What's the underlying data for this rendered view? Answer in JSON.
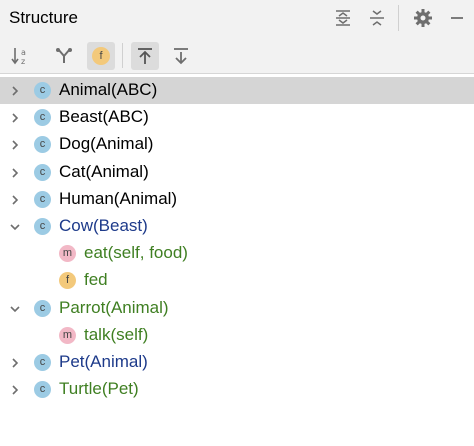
{
  "panel": {
    "title": "Structure"
  },
  "header_icons": [
    "expand-all-icon",
    "collapse-all-icon",
    "gear-icon",
    "minimize-icon"
  ],
  "toolbar": {
    "buttons": [
      {
        "name": "sort-alphabetically-icon"
      },
      {
        "name": "show-inherited-icon"
      },
      {
        "name": "show-fields-icon",
        "glyph": "f",
        "active": true
      },
      {
        "name": "autoscroll-to-source-icon",
        "active": true
      },
      {
        "name": "autoscroll-from-source-icon"
      }
    ]
  },
  "tree": [
    {
      "badge": "c",
      "label": "Animal(ABC)",
      "level": 0,
      "expanded": false,
      "selected": true,
      "color": "#000000"
    },
    {
      "badge": "c",
      "label": "Beast(ABC)",
      "level": 0,
      "expanded": false,
      "color": "#000000"
    },
    {
      "badge": "c",
      "label": "Dog(Animal)",
      "level": 0,
      "expanded": false,
      "color": "#000000"
    },
    {
      "badge": "c",
      "label": "Cat(Animal)",
      "level": 0,
      "expanded": false,
      "color": "#000000"
    },
    {
      "badge": "c",
      "label": "Human(Animal)",
      "level": 0,
      "expanded": false,
      "color": "#000000"
    },
    {
      "badge": "c",
      "label": "Cow(Beast)",
      "level": 0,
      "expanded": true,
      "color": "#1d3a8a"
    },
    {
      "badge": "m",
      "label": "eat(self, food)",
      "level": 1,
      "color": "#3f7f22"
    },
    {
      "badge": "f",
      "label": "fed",
      "level": 1,
      "color": "#3f7f22"
    },
    {
      "badge": "c",
      "label": "Parrot(Animal)",
      "level": 0,
      "expanded": true,
      "color": "#3f7f22"
    },
    {
      "badge": "m",
      "label": "talk(self)",
      "level": 1,
      "color": "#3f7f22"
    },
    {
      "badge": "c",
      "label": "Pet(Animal)",
      "level": 0,
      "expanded": false,
      "color": "#1d3a8a"
    },
    {
      "badge": "c",
      "label": "Turtle(Pet)",
      "level": 0,
      "expanded": false,
      "color": "#3f7f22"
    }
  ]
}
